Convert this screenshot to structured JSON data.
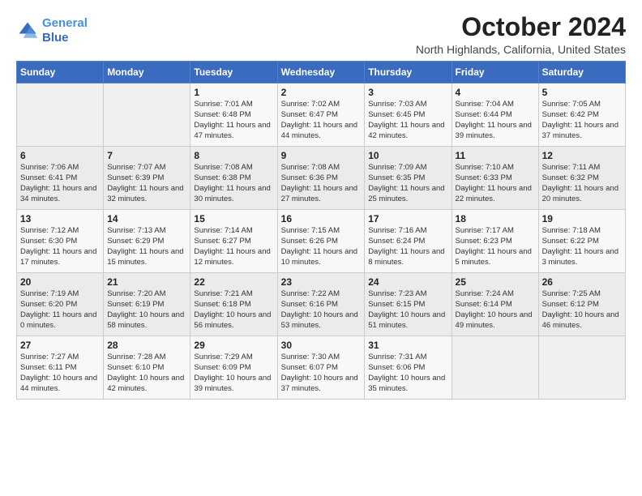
{
  "header": {
    "logo_line1": "General",
    "logo_line2": "Blue",
    "month": "October 2024",
    "location": "North Highlands, California, United States"
  },
  "days_of_week": [
    "Sunday",
    "Monday",
    "Tuesday",
    "Wednesday",
    "Thursday",
    "Friday",
    "Saturday"
  ],
  "weeks": [
    [
      {
        "day": "",
        "detail": ""
      },
      {
        "day": "",
        "detail": ""
      },
      {
        "day": "1",
        "detail": "Sunrise: 7:01 AM\nSunset: 6:48 PM\nDaylight: 11 hours and 47 minutes."
      },
      {
        "day": "2",
        "detail": "Sunrise: 7:02 AM\nSunset: 6:47 PM\nDaylight: 11 hours and 44 minutes."
      },
      {
        "day": "3",
        "detail": "Sunrise: 7:03 AM\nSunset: 6:45 PM\nDaylight: 11 hours and 42 minutes."
      },
      {
        "day": "4",
        "detail": "Sunrise: 7:04 AM\nSunset: 6:44 PM\nDaylight: 11 hours and 39 minutes."
      },
      {
        "day": "5",
        "detail": "Sunrise: 7:05 AM\nSunset: 6:42 PM\nDaylight: 11 hours and 37 minutes."
      }
    ],
    [
      {
        "day": "6",
        "detail": "Sunrise: 7:06 AM\nSunset: 6:41 PM\nDaylight: 11 hours and 34 minutes."
      },
      {
        "day": "7",
        "detail": "Sunrise: 7:07 AM\nSunset: 6:39 PM\nDaylight: 11 hours and 32 minutes."
      },
      {
        "day": "8",
        "detail": "Sunrise: 7:08 AM\nSunset: 6:38 PM\nDaylight: 11 hours and 30 minutes."
      },
      {
        "day": "9",
        "detail": "Sunrise: 7:08 AM\nSunset: 6:36 PM\nDaylight: 11 hours and 27 minutes."
      },
      {
        "day": "10",
        "detail": "Sunrise: 7:09 AM\nSunset: 6:35 PM\nDaylight: 11 hours and 25 minutes."
      },
      {
        "day": "11",
        "detail": "Sunrise: 7:10 AM\nSunset: 6:33 PM\nDaylight: 11 hours and 22 minutes."
      },
      {
        "day": "12",
        "detail": "Sunrise: 7:11 AM\nSunset: 6:32 PM\nDaylight: 11 hours and 20 minutes."
      }
    ],
    [
      {
        "day": "13",
        "detail": "Sunrise: 7:12 AM\nSunset: 6:30 PM\nDaylight: 11 hours and 17 minutes."
      },
      {
        "day": "14",
        "detail": "Sunrise: 7:13 AM\nSunset: 6:29 PM\nDaylight: 11 hours and 15 minutes."
      },
      {
        "day": "15",
        "detail": "Sunrise: 7:14 AM\nSunset: 6:27 PM\nDaylight: 11 hours and 12 minutes."
      },
      {
        "day": "16",
        "detail": "Sunrise: 7:15 AM\nSunset: 6:26 PM\nDaylight: 11 hours and 10 minutes."
      },
      {
        "day": "17",
        "detail": "Sunrise: 7:16 AM\nSunset: 6:24 PM\nDaylight: 11 hours and 8 minutes."
      },
      {
        "day": "18",
        "detail": "Sunrise: 7:17 AM\nSunset: 6:23 PM\nDaylight: 11 hours and 5 minutes."
      },
      {
        "day": "19",
        "detail": "Sunrise: 7:18 AM\nSunset: 6:22 PM\nDaylight: 11 hours and 3 minutes."
      }
    ],
    [
      {
        "day": "20",
        "detail": "Sunrise: 7:19 AM\nSunset: 6:20 PM\nDaylight: 11 hours and 0 minutes."
      },
      {
        "day": "21",
        "detail": "Sunrise: 7:20 AM\nSunset: 6:19 PM\nDaylight: 10 hours and 58 minutes."
      },
      {
        "day": "22",
        "detail": "Sunrise: 7:21 AM\nSunset: 6:18 PM\nDaylight: 10 hours and 56 minutes."
      },
      {
        "day": "23",
        "detail": "Sunrise: 7:22 AM\nSunset: 6:16 PM\nDaylight: 10 hours and 53 minutes."
      },
      {
        "day": "24",
        "detail": "Sunrise: 7:23 AM\nSunset: 6:15 PM\nDaylight: 10 hours and 51 minutes."
      },
      {
        "day": "25",
        "detail": "Sunrise: 7:24 AM\nSunset: 6:14 PM\nDaylight: 10 hours and 49 minutes."
      },
      {
        "day": "26",
        "detail": "Sunrise: 7:25 AM\nSunset: 6:12 PM\nDaylight: 10 hours and 46 minutes."
      }
    ],
    [
      {
        "day": "27",
        "detail": "Sunrise: 7:27 AM\nSunset: 6:11 PM\nDaylight: 10 hours and 44 minutes."
      },
      {
        "day": "28",
        "detail": "Sunrise: 7:28 AM\nSunset: 6:10 PM\nDaylight: 10 hours and 42 minutes."
      },
      {
        "day": "29",
        "detail": "Sunrise: 7:29 AM\nSunset: 6:09 PM\nDaylight: 10 hours and 39 minutes."
      },
      {
        "day": "30",
        "detail": "Sunrise: 7:30 AM\nSunset: 6:07 PM\nDaylight: 10 hours and 37 minutes."
      },
      {
        "day": "31",
        "detail": "Sunrise: 7:31 AM\nSunset: 6:06 PM\nDaylight: 10 hours and 35 minutes."
      },
      {
        "day": "",
        "detail": ""
      },
      {
        "day": "",
        "detail": ""
      }
    ]
  ]
}
